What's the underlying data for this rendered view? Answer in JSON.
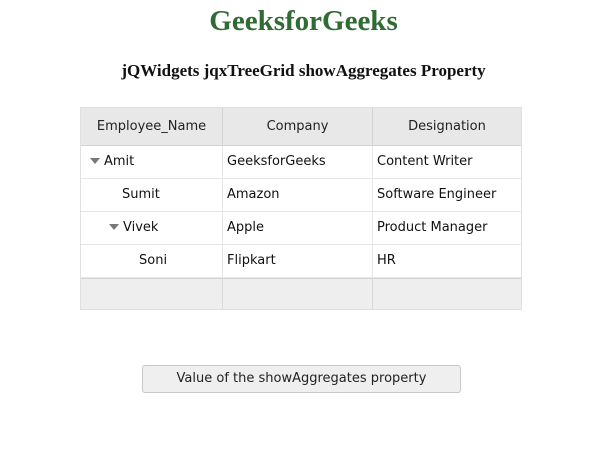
{
  "page": {
    "title": "GeeksforGeeks",
    "subtitle": "jQWidgets jqxTreeGrid showAggregates Property"
  },
  "colors": {
    "title": "#2f6b32",
    "header_bg": "#e8e8e8",
    "aggregates_bg": "#eeeeee"
  },
  "treegrid": {
    "columns": [
      "Employee_Name",
      "Company",
      "Designation"
    ],
    "rows": [
      {
        "name": "Amit",
        "company": "GeeksforGeeks",
        "designation": "Content Writer",
        "level": 0,
        "expanded": true
      },
      {
        "name": "Sumit",
        "company": "Amazon",
        "designation": "Software Engineer",
        "level": 1,
        "expanded": null
      },
      {
        "name": "Vivek",
        "company": "Apple",
        "designation": "Product Manager",
        "level": 1,
        "expanded": true
      },
      {
        "name": "Soni",
        "company": "Flipkart",
        "designation": "HR",
        "level": 2,
        "expanded": null
      }
    ],
    "aggregates_visible": true
  },
  "button": {
    "label": "Value of the showAggregates property"
  }
}
